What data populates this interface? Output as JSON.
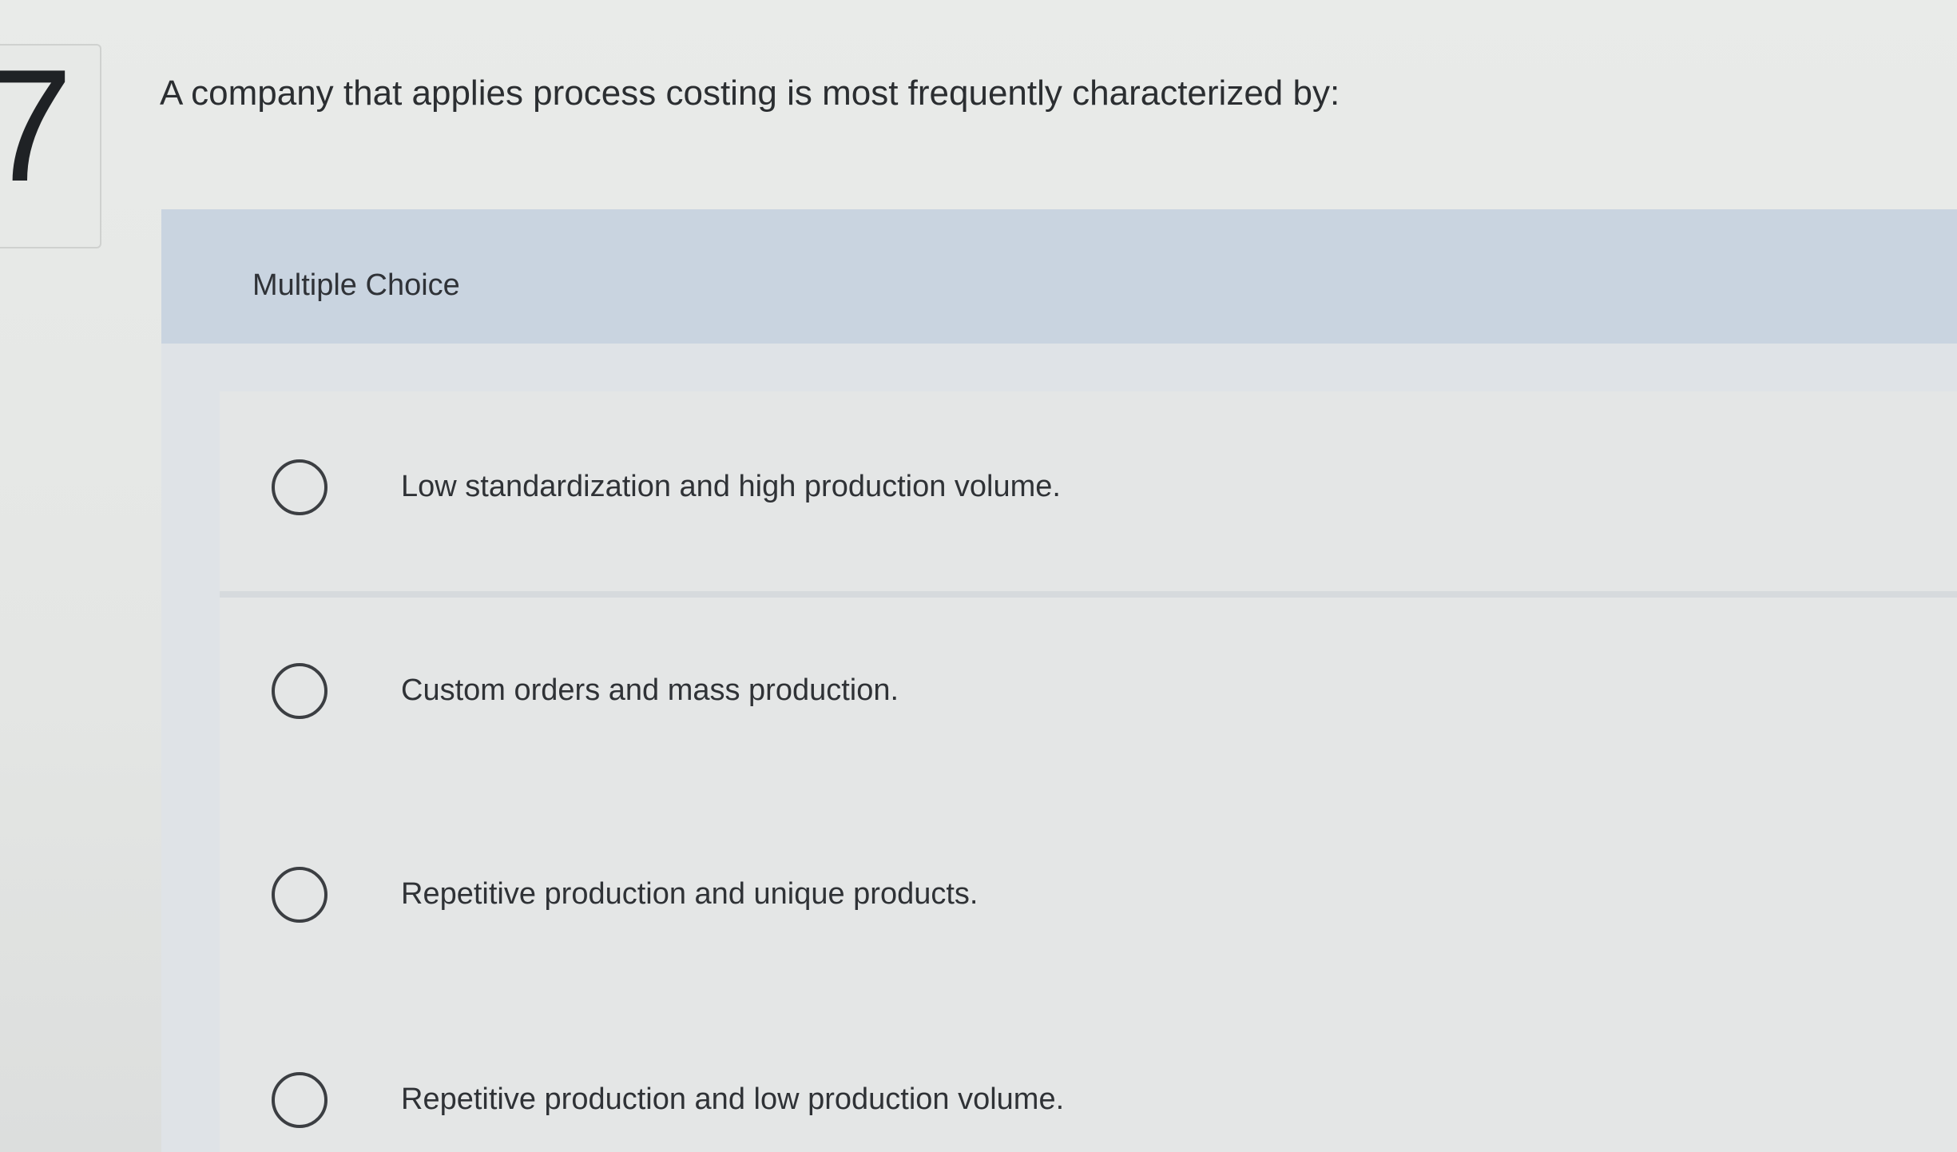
{
  "question": {
    "number": "7",
    "text": "A company that applies process costing is most frequently characterized by:"
  },
  "multiple_choice": {
    "label": "Multiple Choice",
    "options": [
      {
        "text": "Low standardization and high production volume.",
        "selected": false
      },
      {
        "text": "Custom orders and mass production.",
        "selected": false
      },
      {
        "text": "Repetitive production and unique products.",
        "selected": false
      },
      {
        "text": "Repetitive production and low production volume.",
        "selected": false
      }
    ]
  },
  "colors": {
    "header_band": "#c9d4e0",
    "panel": "#dfe3e7",
    "text": "#2f3236"
  }
}
